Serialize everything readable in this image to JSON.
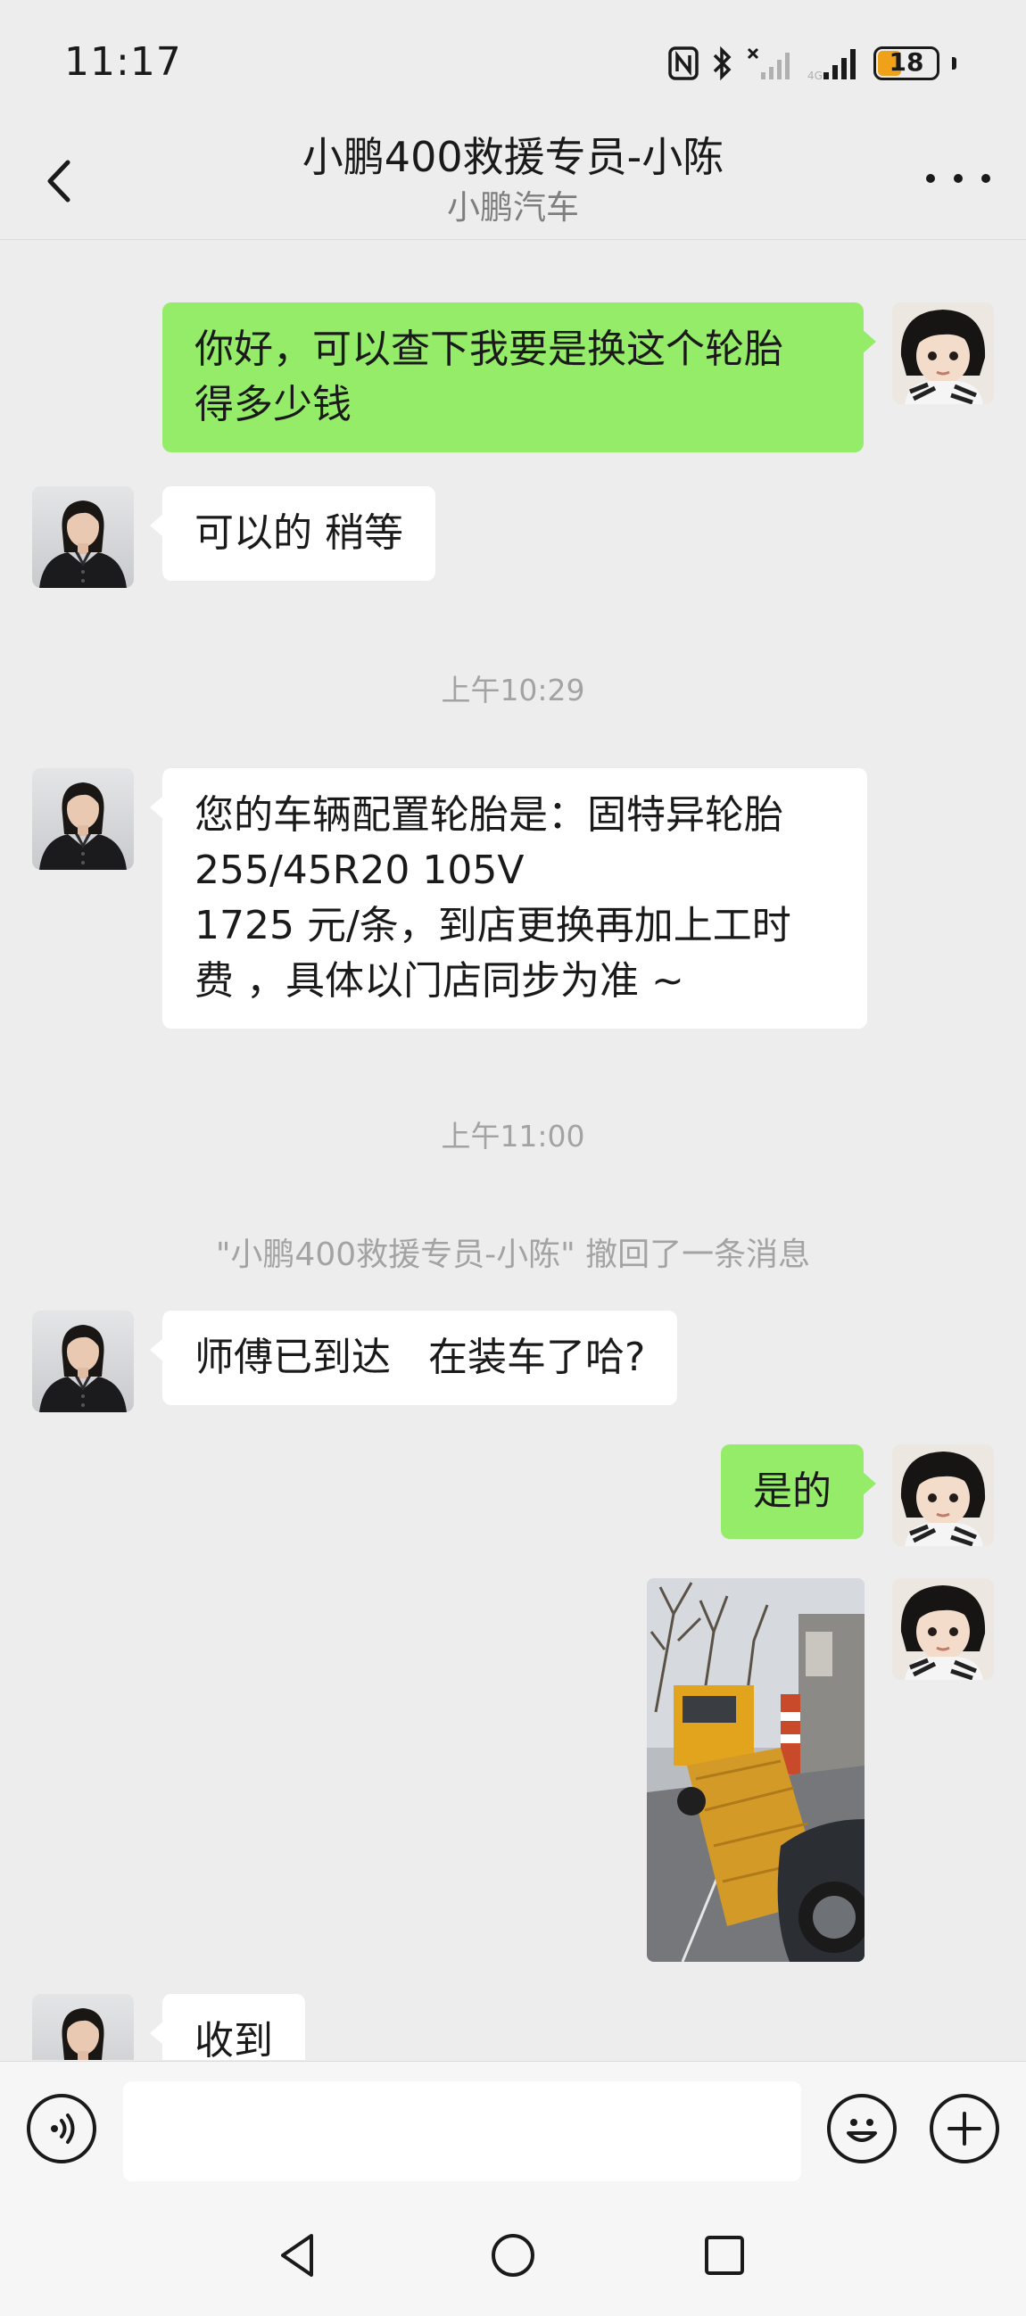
{
  "status_bar": {
    "time": "11:17",
    "battery": "18",
    "icons": [
      "nfc-icon",
      "bluetooth-icon",
      "signal-icon",
      "signal-icon",
      "battery-icon"
    ]
  },
  "header": {
    "title": "小鹏400救援专员-小陈",
    "subtitle": "小鹏汽车",
    "icons": [
      "back-icon",
      "more-icon"
    ]
  },
  "messages": [
    {
      "side": "right",
      "type": "text",
      "text": "你好，可以查下我要是换这个轮胎\n得多少钱"
    },
    {
      "side": "left",
      "type": "text",
      "text": "可以的 稍等"
    },
    {
      "type": "time",
      "text": "上午10:29"
    },
    {
      "side": "left",
      "type": "text",
      "text": "您的车辆配置轮胎是：固特异轮胎\n255/45R20 105V\n1725 元/条，到店更换再加上工时\n费 ，具体以门店同步为准 ~"
    },
    {
      "type": "time",
      "text": "上午11:00"
    },
    {
      "type": "system",
      "text": "\"小鹏400救援专员-小陈\" 撤回了一条消息"
    },
    {
      "side": "left",
      "type": "text",
      "text": "师傅已到达   在装车了哈?"
    },
    {
      "side": "right",
      "type": "text",
      "text": "是的"
    },
    {
      "side": "right",
      "type": "image",
      "text": ""
    },
    {
      "side": "left",
      "type": "text",
      "text": "收到"
    }
  ],
  "input_bar": {
    "placeholder": "",
    "icons": [
      "voice-icon",
      "emoji-icon",
      "plus-icon"
    ]
  },
  "nav_bar": {
    "icons": [
      "nav-back-icon",
      "nav-home-icon",
      "nav-recents-icon"
    ]
  },
  "colors": {
    "background": "#ededed",
    "sent_bubble": "#95ec69",
    "received_bubble": "#ffffff",
    "timestamp": "#a3a3a3",
    "battery": "#f0a11a"
  }
}
